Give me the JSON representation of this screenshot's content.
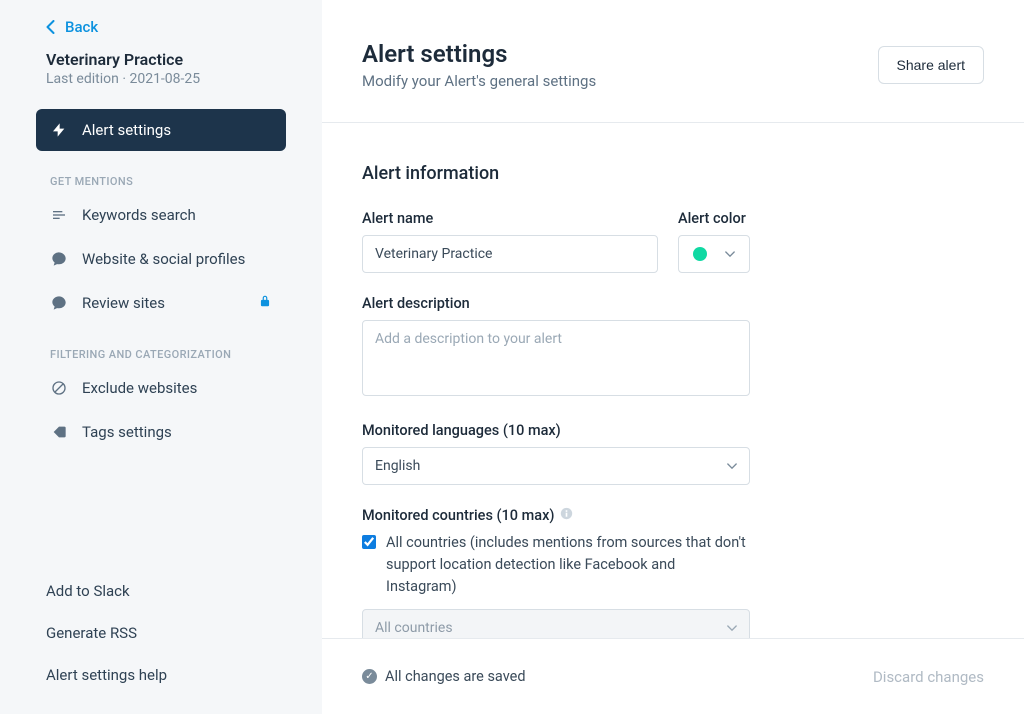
{
  "sidebar": {
    "back_label": "Back",
    "alert_title": "Veterinary Practice",
    "last_edition_label": "Last edition · 2021-08-25",
    "items": {
      "alert_settings": "Alert settings",
      "keywords_search": "Keywords search",
      "website_social": "Website & social profiles",
      "review_sites": "Review sites",
      "exclude_websites": "Exclude websites",
      "tags_settings": "Tags settings"
    },
    "sections": {
      "get_mentions": "GET MENTIONS",
      "filtering": "FILTERING AND CATEGORIZATION"
    },
    "bottom": {
      "add_to_slack": "Add to Slack",
      "generate_rss": "Generate RSS",
      "help": "Alert settings help"
    }
  },
  "header": {
    "title": "Alert settings",
    "subtitle": "Modify your Alert's general settings",
    "share_label": "Share alert"
  },
  "form": {
    "section_title": "Alert information",
    "alert_name_label": "Alert name",
    "alert_name_value": "Veterinary Practice",
    "alert_color_label": "Alert color",
    "alert_color_value": "#10d9a3",
    "description_label": "Alert description",
    "description_placeholder": "Add a description to your alert",
    "languages_label": "Monitored languages (10 max)",
    "languages_value": "English",
    "countries_label": "Monitored countries (10 max)",
    "all_countries_checkbox_label": "All countries (includes mentions from sources that don't support location detection like Facebook and Instagram)",
    "countries_select_value": "All countries"
  },
  "footer": {
    "saved_label": "All changes are saved",
    "discard_label": "Discard changes"
  }
}
